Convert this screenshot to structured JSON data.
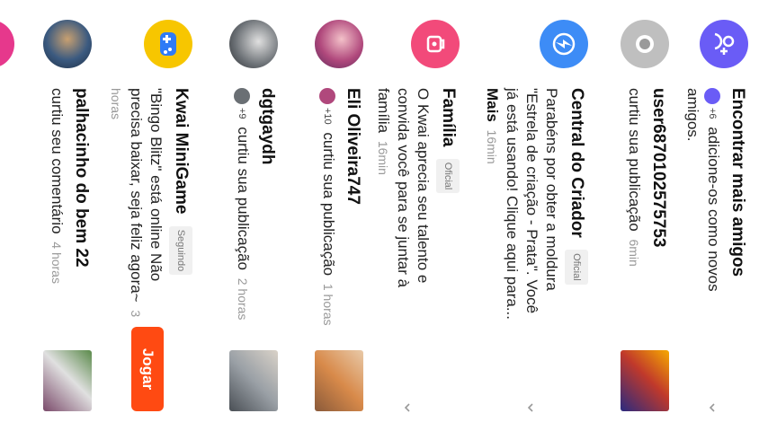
{
  "notifications": [
    {
      "title": "Encontrar mais amigos",
      "mini_count": "+6",
      "text": "adicione-os como novos amigos.",
      "avatar_color": "#6a5cf6",
      "icon": "person-add-icon"
    },
    {
      "title": "user6870102575753",
      "text": "curtiu sua publicação",
      "time": "6min",
      "avatar_color": "#bfbfbf",
      "icon": "default-avatar-icon"
    },
    {
      "title": "Central do Criador",
      "tag": "Oficial",
      "text": "Parabéns por obter a moldura \"Estrela de criação - Prata\". Você já está usando! Clique aqui para...",
      "more": "Mais",
      "time": "16min",
      "avatar_color": "#3d8cf6",
      "icon": "lightning-icon"
    },
    {
      "title": "Família",
      "tag": "Oficial",
      "text": "O Kwai aprecia seu talento e convida você para se juntar à família",
      "time": "16min",
      "avatar_color": "#f24a7a",
      "icon": "family-icon"
    },
    {
      "title": "Eli Oliveira747",
      "mini_count": "+10",
      "text": "curtiu sua publicação",
      "time": "1 horas",
      "avatar_color": "#b0487c"
    },
    {
      "title": "dgtgaydh",
      "mini_count": "+9",
      "text": "curtiu sua publicação",
      "time": "2 horas",
      "avatar_color": "#6a6f74"
    },
    {
      "title": "Kwai MiniGame",
      "tag": "Seguindo",
      "text": "\"Bingo Blitz\" está online Não precisa baixar, seja feliz agora~",
      "time": "3 horas",
      "avatar_color": "#f7c600",
      "icon": "gamepad-icon",
      "button": "Jogar"
    },
    {
      "title": "palhacinho do bem 22",
      "text": "curtiu seu comentário",
      "time": "4 horas",
      "avatar_color": "#3b5a80"
    }
  ]
}
